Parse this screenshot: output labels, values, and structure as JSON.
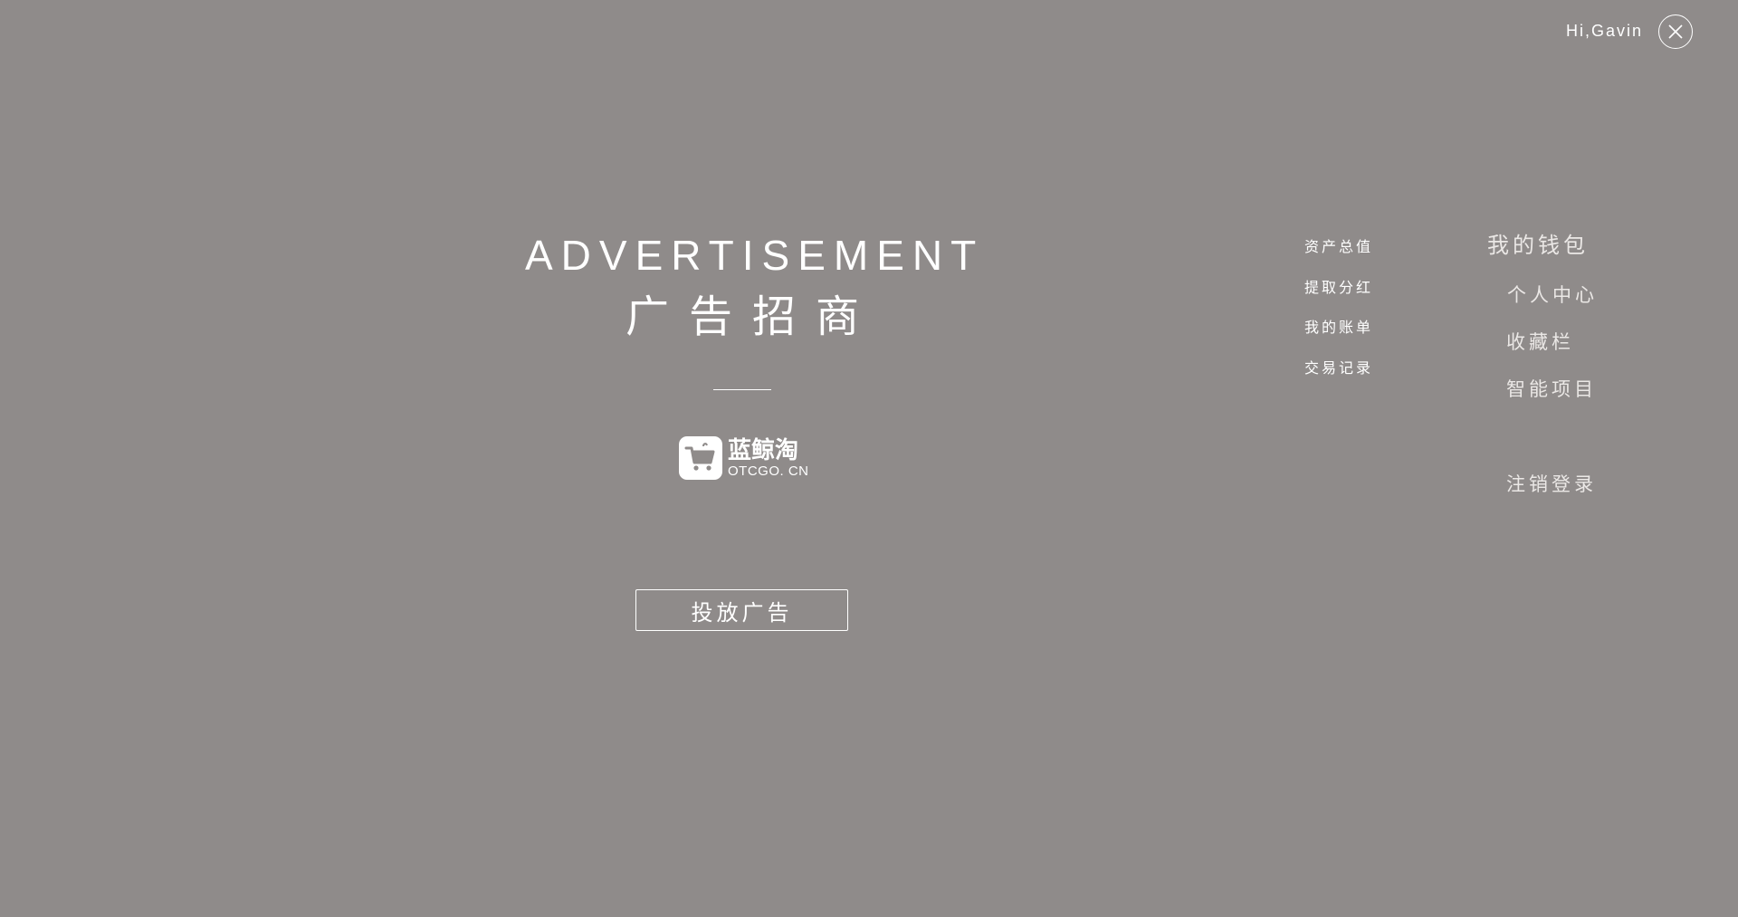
{
  "header": {
    "greeting": "Hi,Gavin",
    "close_icon": "close-icon"
  },
  "advertisement": {
    "title_en": "ADVERTISEMENT",
    "title_cn": "广告招商",
    "logo": {
      "icon": "shopping-cart-icon",
      "name_cn": "蓝鲸淘",
      "name_en": "OTCGO. CN"
    },
    "button_label": "投放广告"
  },
  "wallet_submenu": {
    "items": [
      {
        "label": "资产总值"
      },
      {
        "label": "提取分红"
      },
      {
        "label": "我的账单"
      },
      {
        "label": "交易记录"
      }
    ]
  },
  "main_menu": {
    "wallet": "我的钱包",
    "profile": "个人中心",
    "favorites": "收藏栏",
    "smart_project": "智能项目",
    "logout": "注销登录"
  },
  "colors": {
    "background": "#8f8b8a",
    "text": "#ffffff",
    "menu_text": "#ebe8e6"
  }
}
